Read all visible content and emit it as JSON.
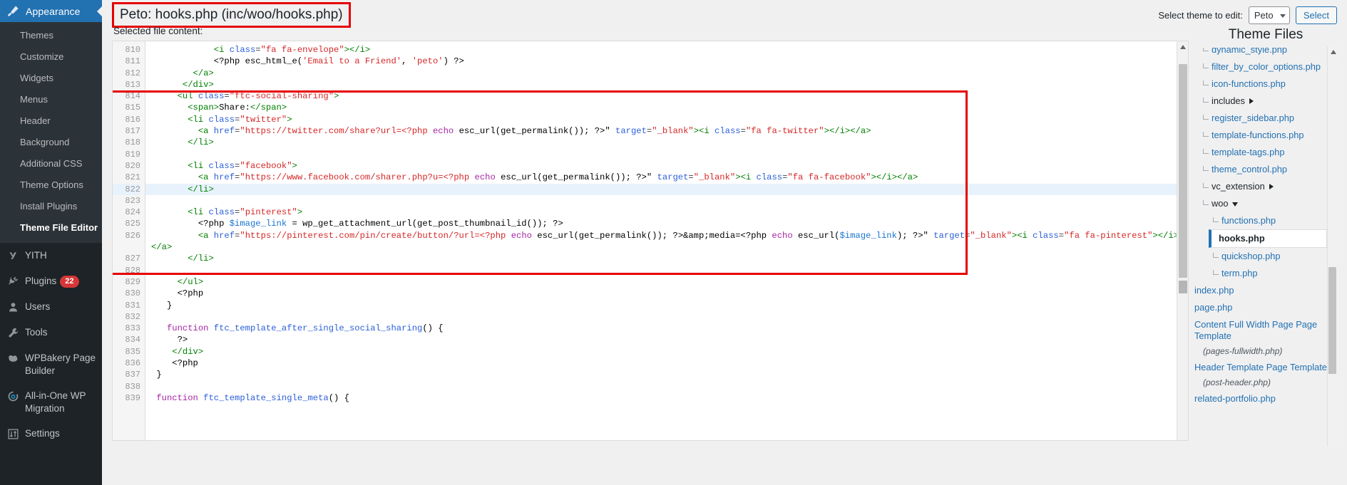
{
  "sidebar": {
    "active_top": {
      "label": "Appearance",
      "icon": "paintbrush-icon"
    },
    "submenu": [
      {
        "label": "Themes",
        "current": false
      },
      {
        "label": "Customize",
        "current": false
      },
      {
        "label": "Widgets",
        "current": false
      },
      {
        "label": "Menus",
        "current": false
      },
      {
        "label": "Header",
        "current": false
      },
      {
        "label": "Background",
        "current": false
      },
      {
        "label": "Additional CSS",
        "current": false
      },
      {
        "label": "Theme Options",
        "current": false
      },
      {
        "label": "Install Plugins",
        "current": false
      },
      {
        "label": "Theme File Editor",
        "current": true
      }
    ],
    "items": [
      {
        "label": "YITH",
        "icon": "yith-icon",
        "badge": null
      },
      {
        "label": "Plugins",
        "icon": "plug-icon",
        "badge": "22"
      },
      {
        "label": "Users",
        "icon": "user-icon",
        "badge": null
      },
      {
        "label": "Tools",
        "icon": "wrench-icon",
        "badge": null
      },
      {
        "label": "WPBakery Page Builder",
        "icon": "cloud-icon",
        "badge": null
      },
      {
        "label": "All-in-One WP Migration",
        "icon": "migration-icon",
        "badge": null
      },
      {
        "label": "Settings",
        "icon": "sliders-icon",
        "badge": null
      }
    ]
  },
  "topbar": {
    "file_title": "Peto: hooks.php (inc/woo/hooks.php)",
    "select_theme_label": "Select theme to edit:",
    "theme_value": "Peto",
    "select_button": "Select"
  },
  "editor": {
    "selected_file_label": "Selected file content:",
    "active_line": 822,
    "first_line": 810,
    "lines": [
      {
        "n": 810,
        "indent": 12,
        "tokens": [
          {
            "t": "tag",
            "v": "<i "
          },
          {
            "t": "attr",
            "v": "class"
          },
          {
            "t": "punc",
            "v": "="
          },
          {
            "t": "str",
            "v": "\"fa fa-envelope\""
          },
          {
            "t": "tag",
            "v": "></i>"
          }
        ]
      },
      {
        "n": 811,
        "indent": 12,
        "tokens": [
          {
            "t": "plain",
            "v": "<?php esc_html_e("
          },
          {
            "t": "str",
            "v": "'Email to a Friend'"
          },
          {
            "t": "plain",
            "v": ", "
          },
          {
            "t": "str",
            "v": "'peto'"
          },
          {
            "t": "plain",
            "v": ") ?>"
          }
        ]
      },
      {
        "n": 812,
        "indent": 8,
        "tokens": [
          {
            "t": "tag",
            "v": "</a>"
          }
        ]
      },
      {
        "n": 813,
        "indent": 6,
        "tokens": [
          {
            "t": "tag",
            "v": "</div>"
          }
        ]
      },
      {
        "n": 814,
        "indent": 5,
        "tokens": [
          {
            "t": "tag",
            "v": "<ul "
          },
          {
            "t": "attr",
            "v": "class"
          },
          {
            "t": "punc",
            "v": "="
          },
          {
            "t": "str",
            "v": "\"ftc-social-sharing\""
          },
          {
            "t": "tag",
            "v": ">"
          }
        ]
      },
      {
        "n": 815,
        "indent": 7,
        "tokens": [
          {
            "t": "tag",
            "v": "<span>"
          },
          {
            "t": "plain",
            "v": "Share:"
          },
          {
            "t": "tag",
            "v": "</span>"
          }
        ]
      },
      {
        "n": 816,
        "indent": 7,
        "tokens": [
          {
            "t": "tag",
            "v": "<li "
          },
          {
            "t": "attr",
            "v": "class"
          },
          {
            "t": "punc",
            "v": "="
          },
          {
            "t": "str",
            "v": "\"twitter\""
          },
          {
            "t": "tag",
            "v": ">"
          }
        ]
      },
      {
        "n": 817,
        "indent": 9,
        "tokens": [
          {
            "t": "tag",
            "v": "<a "
          },
          {
            "t": "attr",
            "v": "href"
          },
          {
            "t": "punc",
            "v": "="
          },
          {
            "t": "str",
            "v": "\"https://twitter.com/share?url=<?php "
          },
          {
            "t": "kw",
            "v": "echo"
          },
          {
            "t": "plain",
            "v": " esc_url(get_permalink()); ?>\""
          },
          {
            "t": "plain",
            "v": " "
          },
          {
            "t": "attr",
            "v": "target"
          },
          {
            "t": "punc",
            "v": "="
          },
          {
            "t": "str",
            "v": "\"_blank\""
          },
          {
            "t": "tag",
            "v": "><i "
          },
          {
            "t": "attr",
            "v": "class"
          },
          {
            "t": "punc",
            "v": "="
          },
          {
            "t": "str",
            "v": "\"fa fa-twitter\""
          },
          {
            "t": "tag",
            "v": "></i></a>"
          }
        ]
      },
      {
        "n": 818,
        "indent": 7,
        "tokens": [
          {
            "t": "tag",
            "v": "</li>"
          }
        ]
      },
      {
        "n": 819,
        "indent": 0,
        "tokens": []
      },
      {
        "n": 820,
        "indent": 7,
        "tokens": [
          {
            "t": "tag",
            "v": "<li "
          },
          {
            "t": "attr",
            "v": "class"
          },
          {
            "t": "punc",
            "v": "="
          },
          {
            "t": "str",
            "v": "\"facebook\""
          },
          {
            "t": "tag",
            "v": ">"
          }
        ]
      },
      {
        "n": 821,
        "indent": 9,
        "tokens": [
          {
            "t": "tag",
            "v": "<a "
          },
          {
            "t": "attr",
            "v": "href"
          },
          {
            "t": "punc",
            "v": "="
          },
          {
            "t": "str",
            "v": "\"https://www.facebook.com/sharer.php?u=<?php "
          },
          {
            "t": "kw",
            "v": "echo"
          },
          {
            "t": "plain",
            "v": " esc_url(get_permalink()); ?>\""
          },
          {
            "t": "plain",
            "v": " "
          },
          {
            "t": "attr",
            "v": "target"
          },
          {
            "t": "punc",
            "v": "="
          },
          {
            "t": "str",
            "v": "\"_blank\""
          },
          {
            "t": "tag",
            "v": "><i "
          },
          {
            "t": "attr",
            "v": "class"
          },
          {
            "t": "punc",
            "v": "="
          },
          {
            "t": "str",
            "v": "\"fa fa-facebook\""
          },
          {
            "t": "tag",
            "v": "></i></a>"
          }
        ]
      },
      {
        "n": 822,
        "indent": 7,
        "tokens": [
          {
            "t": "tag",
            "v": "</li>"
          }
        ]
      },
      {
        "n": 823,
        "indent": 0,
        "tokens": []
      },
      {
        "n": 824,
        "indent": 7,
        "tokens": [
          {
            "t": "tag",
            "v": "<li "
          },
          {
            "t": "attr",
            "v": "class"
          },
          {
            "t": "punc",
            "v": "="
          },
          {
            "t": "str",
            "v": "\"pinterest\""
          },
          {
            "t": "tag",
            "v": ">"
          }
        ]
      },
      {
        "n": 825,
        "indent": 9,
        "tokens": [
          {
            "t": "plain",
            "v": "<?php "
          },
          {
            "t": "var",
            "v": "$image_link"
          },
          {
            "t": "plain",
            "v": " = wp_get_attachment_url(get_post_thumbnail_id()); ?>"
          }
        ]
      },
      {
        "n": 826,
        "indent": 9,
        "wrapped": true,
        "tokens": [
          {
            "t": "tag",
            "v": "<a "
          },
          {
            "t": "attr",
            "v": "href"
          },
          {
            "t": "punc",
            "v": "="
          },
          {
            "t": "str",
            "v": "\"https://pinterest.com/pin/create/button/?url=<?php "
          },
          {
            "t": "kw",
            "v": "echo"
          },
          {
            "t": "plain",
            "v": " esc_url(get_permalink()); ?>&amp;media=<?php "
          },
          {
            "t": "kw",
            "v": "echo"
          },
          {
            "t": "plain",
            "v": " esc_url("
          },
          {
            "t": "var",
            "v": "$image_link"
          },
          {
            "t": "plain",
            "v": "); ?>\""
          },
          {
            "t": "plain",
            "v": " "
          },
          {
            "t": "attr",
            "v": "target"
          },
          {
            "t": "punc",
            "v": "="
          },
          {
            "t": "str",
            "v": "\"_blank\""
          },
          {
            "t": "tag",
            "v": "><i "
          },
          {
            "t": "attr",
            "v": "class"
          },
          {
            "t": "punc",
            "v": "="
          },
          {
            "t": "str",
            "v": "\"fa fa-pinterest\""
          },
          {
            "t": "tag",
            "v": "></i></a>"
          }
        ]
      },
      {
        "n": 827,
        "indent": 7,
        "tokens": [
          {
            "t": "tag",
            "v": "</li>"
          }
        ]
      },
      {
        "n": 828,
        "indent": 0,
        "tokens": []
      },
      {
        "n": 829,
        "indent": 5,
        "tokens": [
          {
            "t": "tag",
            "v": "</ul>"
          }
        ]
      },
      {
        "n": 830,
        "indent": 5,
        "tokens": [
          {
            "t": "plain",
            "v": "<?php"
          }
        ]
      },
      {
        "n": 831,
        "indent": 3,
        "tokens": [
          {
            "t": "plain",
            "v": "}"
          }
        ]
      },
      {
        "n": 832,
        "indent": 0,
        "tokens": []
      },
      {
        "n": 833,
        "indent": 3,
        "tokens": [
          {
            "t": "kw",
            "v": "function"
          },
          {
            "t": "plain",
            "v": " "
          },
          {
            "t": "attr",
            "v": "ftc_template_after_single_social_sharing"
          },
          {
            "t": "plain",
            "v": "() {"
          }
        ]
      },
      {
        "n": 834,
        "indent": 5,
        "tokens": [
          {
            "t": "plain",
            "v": "?>"
          }
        ]
      },
      {
        "n": 835,
        "indent": 4,
        "tokens": [
          {
            "t": "tag",
            "v": "</div>"
          }
        ]
      },
      {
        "n": 836,
        "indent": 4,
        "tokens": [
          {
            "t": "plain",
            "v": "<?php"
          }
        ]
      },
      {
        "n": 837,
        "indent": 1,
        "tokens": [
          {
            "t": "plain",
            "v": "}"
          }
        ]
      },
      {
        "n": 838,
        "indent": 0,
        "tokens": []
      },
      {
        "n": 839,
        "indent": 1,
        "tokens": [
          {
            "t": "kw",
            "v": "function"
          },
          {
            "t": "plain",
            "v": " "
          },
          {
            "t": "attr",
            "v": "ftc_template_single_meta"
          },
          {
            "t": "plain",
            "v": "() {"
          }
        ]
      }
    ]
  },
  "theme_files": {
    "title": "Theme Files",
    "entries": [
      {
        "label": "dynamic_style.php",
        "type": "file",
        "indent": 1,
        "clipped": true
      },
      {
        "label": "filter_by_color_options.php",
        "type": "file",
        "indent": 1
      },
      {
        "label": "icon-functions.php",
        "type": "file",
        "indent": 1
      },
      {
        "label": "includes",
        "type": "folder-collapsed",
        "indent": 1
      },
      {
        "label": "register_sidebar.php",
        "type": "file",
        "indent": 1
      },
      {
        "label": "template-functions.php",
        "type": "file",
        "indent": 1
      },
      {
        "label": "template-tags.php",
        "type": "file",
        "indent": 1
      },
      {
        "label": "theme_control.php",
        "type": "file",
        "indent": 1
      },
      {
        "label": "vc_extension",
        "type": "folder-collapsed",
        "indent": 1
      },
      {
        "label": "woo",
        "type": "folder-expanded",
        "indent": 1
      },
      {
        "label": "functions.php",
        "type": "file",
        "indent": 2
      },
      {
        "label": "hooks.php",
        "type": "file-selected",
        "indent": 2
      },
      {
        "label": "quickshop.php",
        "type": "file",
        "indent": 2
      },
      {
        "label": "term.php",
        "type": "file",
        "indent": 2
      },
      {
        "label": "index.php",
        "type": "file-root",
        "indent": 0
      },
      {
        "label": "page.php",
        "type": "file-root",
        "indent": 0
      },
      {
        "label": "Content Full Width Page Page Template",
        "sub": "(pages-fullwidth.php)",
        "type": "file-root-wrap",
        "indent": 0
      },
      {
        "label": "Header Template Page Template",
        "sub": "(post-header.php)",
        "type": "file-root-wrap",
        "indent": 0
      },
      {
        "label": "related-portfolio.php",
        "type": "file-root",
        "indent": 0
      }
    ]
  },
  "annotations": {
    "title_box_color": "#e60000",
    "code_box_color": "#e60000"
  }
}
